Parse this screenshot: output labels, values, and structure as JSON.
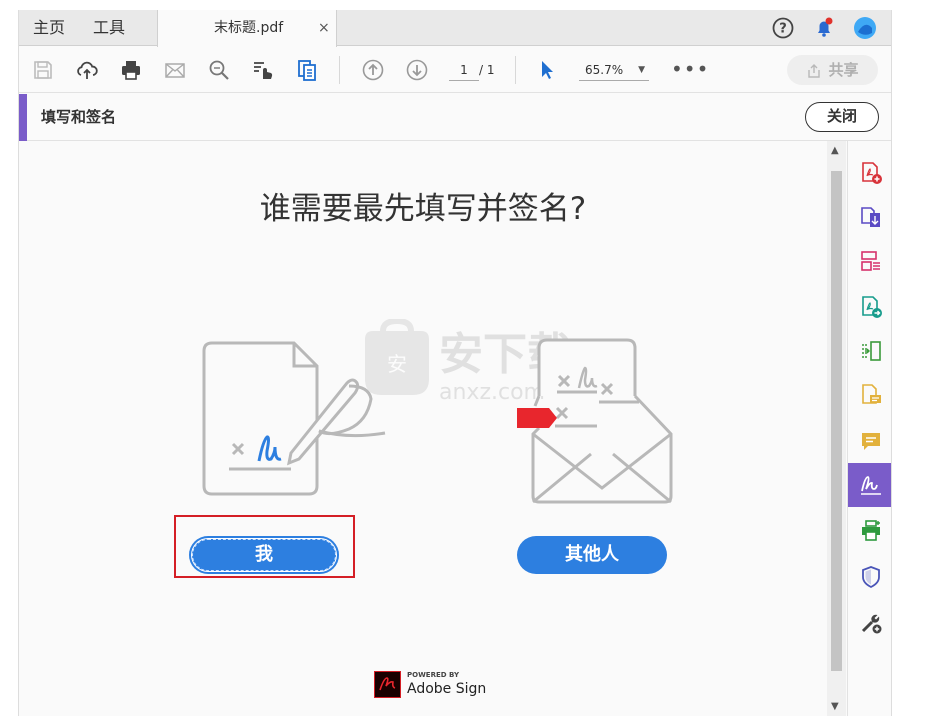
{
  "tabbar": {
    "home_label": "主页",
    "tools_label": "工具",
    "doc_tab_title": "末标题.pdf",
    "doc_tab_close": "×"
  },
  "toolbar": {
    "page_current": "1",
    "page_total": "/ 1",
    "zoom_value": "65.7%",
    "more": "•••",
    "share_label": "共享",
    "icons": [
      "save-icon",
      "cloud-upload-icon",
      "print-icon",
      "email-icon",
      "find-icon",
      "touch-mode-icon",
      "organize-pages-icon",
      "page-up-icon",
      "page-down-icon",
      "select-cursor-icon"
    ]
  },
  "header_icons": [
    "help-icon",
    "notification-bell-icon",
    "user-avatar-icon"
  ],
  "fill_sign": {
    "title": "填写和签名",
    "close_label": "关闭"
  },
  "main": {
    "heading": "谁需要最先填写并签名?",
    "button_me": "我",
    "button_others": "其他人",
    "powered_by_small": "POWERED BY",
    "powered_by_brand": "Adobe Sign",
    "watermark_text": "安下载",
    "watermark_domain": "anxz.com"
  },
  "right_panel": {
    "items": [
      "create-pdf-icon",
      "export-pdf-icon",
      "organize-pages-icon",
      "combine-files-icon",
      "edit-pdf-icon",
      "send-for-comments-icon",
      "comment-icon",
      "fill-sign-icon",
      "print-production-icon",
      "protect-icon",
      "more-tools-icon"
    ],
    "active_index": 7
  },
  "colors": {
    "accent_purple": "#7a5cc9",
    "button_blue": "#2d7fe0",
    "highlight_red": "#d41e25"
  }
}
